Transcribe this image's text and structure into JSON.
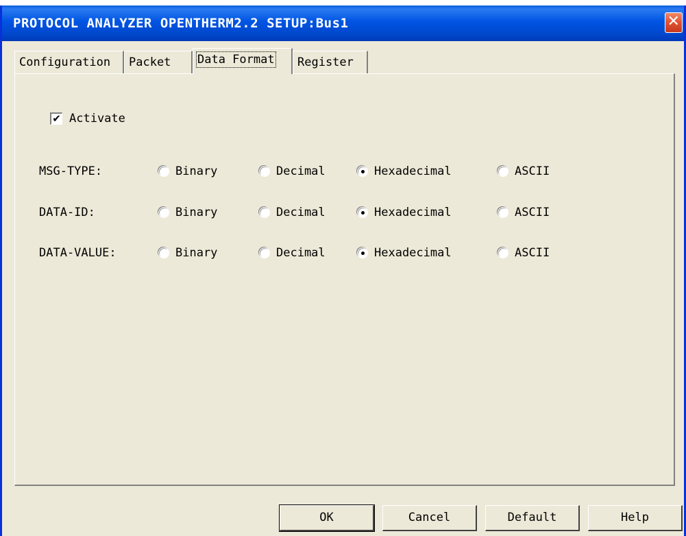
{
  "window": {
    "title": "PROTOCOL ANALYZER OPENTHERM2.2 SETUP:Bus1",
    "close_glyph": "✕"
  },
  "tabs": [
    {
      "label": "Configuration",
      "active": false
    },
    {
      "label": "Packet",
      "active": false
    },
    {
      "label": "Data Format",
      "active": true
    },
    {
      "label": "Register",
      "active": false
    }
  ],
  "activate": {
    "label": "Activate",
    "checked": true,
    "check_glyph": "✔"
  },
  "format_rows": [
    {
      "label": "MSG-TYPE:",
      "options": [
        "Binary",
        "Decimal",
        "Hexadecimal",
        "ASCII"
      ],
      "selected": "Hexadecimal"
    },
    {
      "label": "DATA-ID:",
      "options": [
        "Binary",
        "Decimal",
        "Hexadecimal",
        "ASCII"
      ],
      "selected": "Hexadecimal"
    },
    {
      "label": "DATA-VALUE:",
      "options": [
        "Binary",
        "Decimal",
        "Hexadecimal",
        "ASCII"
      ],
      "selected": "Hexadecimal"
    }
  ],
  "buttons": {
    "ok": "OK",
    "cancel": "Cancel",
    "default": "Default",
    "help": "Help"
  },
  "colors": {
    "titlebar": "#0054e3",
    "dialog_bg": "#ece9d8",
    "close_button": "#e35030"
  }
}
